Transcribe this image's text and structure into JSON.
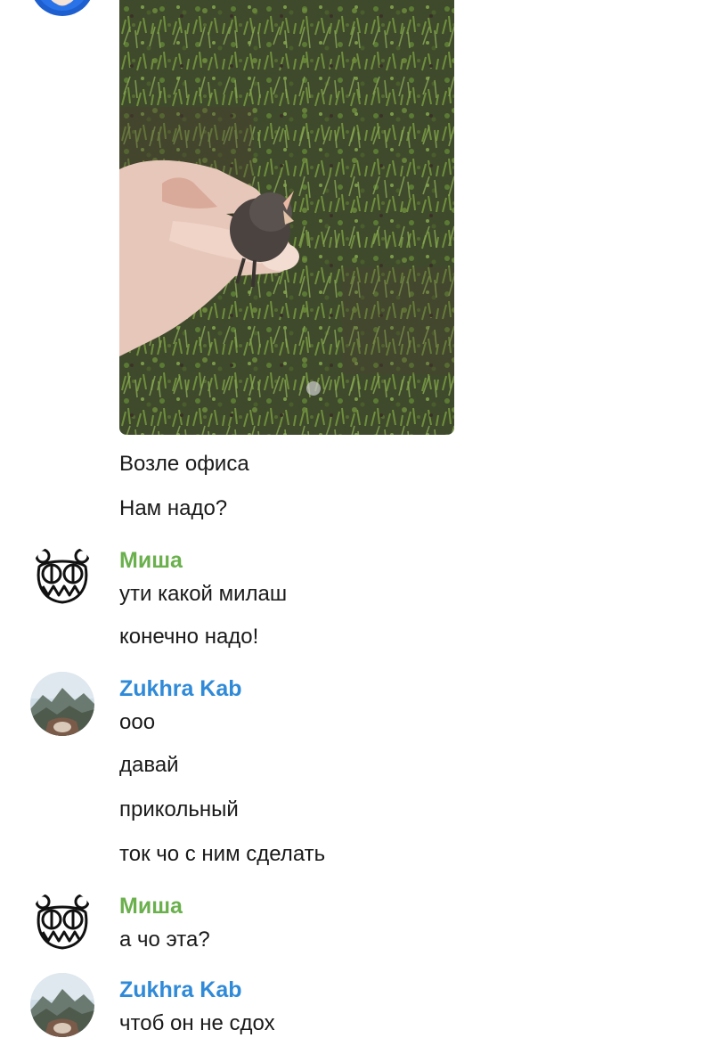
{
  "colors": {
    "misha_name": "#6ab04c",
    "zukhra_name": "#2f8ad8",
    "text": "#1a1a1a"
  },
  "groups": [
    {
      "avatar_icon": "blue-avatar-icon",
      "attachment_icon": "bird-photo-icon",
      "messages": [
        "Возле офиса",
        "Нам надо?"
      ]
    },
    {
      "sender": "Миша",
      "avatar_icon": "radiohead-bear-avatar-icon",
      "messages": [
        "ути какой милаш",
        "конечно надо!"
      ]
    },
    {
      "sender": "Zukhra Kab",
      "avatar_icon": "mountain-avatar-icon",
      "messages": [
        "ооо",
        "давай",
        "прикольный",
        "ток чо с ним сделать"
      ]
    },
    {
      "sender": "Миша",
      "avatar_icon": "radiohead-bear-avatar-icon",
      "messages": [
        "а чо эта?"
      ]
    },
    {
      "sender": "Zukhra Kab",
      "avatar_icon": "mountain-avatar-icon",
      "messages": [
        "чтоб он не сдох"
      ]
    }
  ]
}
